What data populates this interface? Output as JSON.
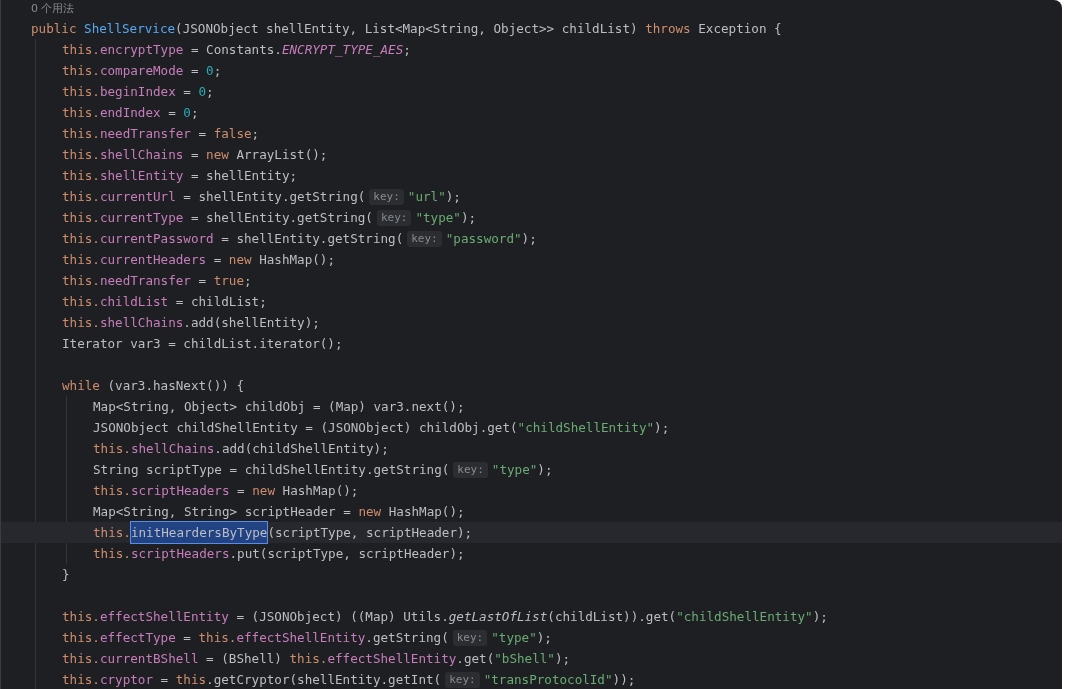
{
  "usage_hint": "0 个用法",
  "lines": [
    {
      "tokens": [
        {
          "kind": "keyword",
          "text": "public "
        },
        {
          "kind": "declaration",
          "text": "ShellService"
        },
        {
          "kind": "plain",
          "text": "(JSONObject shellEntity, List<Map<String, Object>> childList) "
        },
        {
          "kind": "keyword",
          "text": "throws "
        },
        {
          "kind": "plain",
          "text": "Exception {"
        }
      ],
      "children": [
        {
          "tokens": [
            {
              "kind": "receiver",
              "text": "this."
            },
            {
              "kind": "field",
              "text": "encryptType"
            },
            {
              "kind": "plain",
              "text": " = Constants."
            },
            {
              "kind": "constant",
              "text": "ENCRYPT_TYPE_AES"
            },
            {
              "kind": "plain",
              "text": ";"
            }
          ]
        },
        {
          "tokens": [
            {
              "kind": "receiver",
              "text": "this."
            },
            {
              "kind": "field",
              "text": "compareMode"
            },
            {
              "kind": "plain",
              "text": " = "
            },
            {
              "kind": "number",
              "text": "0"
            },
            {
              "kind": "plain",
              "text": ";"
            }
          ]
        },
        {
          "tokens": [
            {
              "kind": "receiver",
              "text": "this."
            },
            {
              "kind": "field",
              "text": "beginIndex"
            },
            {
              "kind": "plain",
              "text": " = "
            },
            {
              "kind": "number",
              "text": "0"
            },
            {
              "kind": "plain",
              "text": ";"
            }
          ]
        },
        {
          "tokens": [
            {
              "kind": "receiver",
              "text": "this."
            },
            {
              "kind": "field",
              "text": "endIndex"
            },
            {
              "kind": "plain",
              "text": " = "
            },
            {
              "kind": "number",
              "text": "0"
            },
            {
              "kind": "plain",
              "text": ";"
            }
          ]
        },
        {
          "tokens": [
            {
              "kind": "receiver",
              "text": "this."
            },
            {
              "kind": "field",
              "text": "needTransfer"
            },
            {
              "kind": "plain",
              "text": " = "
            },
            {
              "kind": "keyword",
              "text": "false"
            },
            {
              "kind": "plain",
              "text": ";"
            }
          ]
        },
        {
          "tokens": [
            {
              "kind": "receiver",
              "text": "this."
            },
            {
              "kind": "field",
              "text": "shellChains"
            },
            {
              "kind": "plain",
              "text": " = "
            },
            {
              "kind": "keyword",
              "text": "new "
            },
            {
              "kind": "plain",
              "text": "ArrayList();"
            }
          ]
        },
        {
          "tokens": [
            {
              "kind": "receiver",
              "text": "this."
            },
            {
              "kind": "field",
              "text": "shellEntity"
            },
            {
              "kind": "plain",
              "text": " = shellEntity;"
            }
          ]
        },
        {
          "tokens": [
            {
              "kind": "receiver",
              "text": "this."
            },
            {
              "kind": "field",
              "text": "currentUrl"
            },
            {
              "kind": "plain",
              "text": " = shellEntity.getString("
            },
            {
              "kind": "hint",
              "text": "key:"
            },
            {
              "kind": "string",
              "text": "\"url\""
            },
            {
              "kind": "plain",
              "text": ");"
            }
          ]
        },
        {
          "tokens": [
            {
              "kind": "receiver",
              "text": "this."
            },
            {
              "kind": "field",
              "text": "currentType"
            },
            {
              "kind": "plain",
              "text": " = shellEntity.getString("
            },
            {
              "kind": "hint",
              "text": "key:"
            },
            {
              "kind": "string",
              "text": "\"type\""
            },
            {
              "kind": "plain",
              "text": ");"
            }
          ]
        },
        {
          "tokens": [
            {
              "kind": "receiver",
              "text": "this."
            },
            {
              "kind": "field",
              "text": "currentPassword"
            },
            {
              "kind": "plain",
              "text": " = shellEntity.getString("
            },
            {
              "kind": "hint",
              "text": "key:"
            },
            {
              "kind": "string",
              "text": "\"password\""
            },
            {
              "kind": "plain",
              "text": ");"
            }
          ]
        },
        {
          "tokens": [
            {
              "kind": "receiver",
              "text": "this."
            },
            {
              "kind": "field",
              "text": "currentHeaders"
            },
            {
              "kind": "plain",
              "text": " = "
            },
            {
              "kind": "keyword",
              "text": "new "
            },
            {
              "kind": "plain",
              "text": "HashMap();"
            }
          ]
        },
        {
          "tokens": [
            {
              "kind": "receiver",
              "text": "this."
            },
            {
              "kind": "field",
              "text": "needTransfer"
            },
            {
              "kind": "plain",
              "text": " = "
            },
            {
              "kind": "keyword",
              "text": "true"
            },
            {
              "kind": "plain",
              "text": ";"
            }
          ]
        },
        {
          "tokens": [
            {
              "kind": "receiver",
              "text": "this."
            },
            {
              "kind": "field",
              "text": "childList"
            },
            {
              "kind": "plain",
              "text": " = childList;"
            }
          ]
        },
        {
          "tokens": [
            {
              "kind": "receiver",
              "text": "this."
            },
            {
              "kind": "field",
              "text": "shellChains"
            },
            {
              "kind": "plain",
              "text": ".add(shellEntity);"
            }
          ]
        },
        {
          "tokens": [
            {
              "kind": "plain",
              "text": "Iterator var3 = childList.iterator();"
            }
          ]
        },
        {
          "kind": "blank"
        },
        {
          "tokens": [
            {
              "kind": "keyword",
              "text": "while "
            },
            {
              "kind": "plain",
              "text": "(var3.hasNext()) {"
            }
          ],
          "children": [
            {
              "tokens": [
                {
                  "kind": "plain",
                  "text": "Map<String, Object> childObj = (Map) var3.next();"
                }
              ]
            },
            {
              "tokens": [
                {
                  "kind": "plain",
                  "text": "JSONObject childShellEntity = (JSONObject) childObj.get("
                },
                {
                  "kind": "string",
                  "text": "\"childShellEntity\""
                },
                {
                  "kind": "plain",
                  "text": ");"
                }
              ]
            },
            {
              "tokens": [
                {
                  "kind": "receiver",
                  "text": "this."
                },
                {
                  "kind": "field",
                  "text": "shellChains"
                },
                {
                  "kind": "plain",
                  "text": ".add(childShellEntity);"
                }
              ]
            },
            {
              "tokens": [
                {
                  "kind": "plain",
                  "text": "String scriptType = childShellEntity.getString("
                },
                {
                  "kind": "hint",
                  "text": "key:"
                },
                {
                  "kind": "string",
                  "text": "\"type\""
                },
                {
                  "kind": "plain",
                  "text": ");"
                }
              ]
            },
            {
              "tokens": [
                {
                  "kind": "receiver",
                  "text": "this."
                },
                {
                  "kind": "field",
                  "text": "scriptHeaders"
                },
                {
                  "kind": "plain",
                  "text": " = "
                },
                {
                  "kind": "keyword",
                  "text": "new "
                },
                {
                  "kind": "plain",
                  "text": "HashMap();"
                }
              ]
            },
            {
              "tokens": [
                {
                  "kind": "plain",
                  "text": "Map<String, String> scriptHeader = "
                },
                {
                  "kind": "keyword",
                  "text": "new "
                },
                {
                  "kind": "plain",
                  "text": "HashMap();"
                }
              ]
            },
            {
              "current": true,
              "tokens": [
                {
                  "kind": "receiver",
                  "text": "this."
                },
                {
                  "kind": "selection",
                  "text": "initHeardersByType"
                },
                {
                  "kind": "plain",
                  "text": "(scriptType, scriptHeader);"
                }
              ]
            },
            {
              "tokens": [
                {
                  "kind": "receiver",
                  "text": "this."
                },
                {
                  "kind": "field",
                  "text": "scriptHeaders"
                },
                {
                  "kind": "plain",
                  "text": ".put(scriptType, scriptHeader);"
                }
              ]
            }
          ]
        },
        {
          "tokens": [
            {
              "kind": "plain",
              "text": "}"
            }
          ]
        },
        {
          "kind": "blank"
        },
        {
          "tokens": [
            {
              "kind": "receiver",
              "text": "this."
            },
            {
              "kind": "field",
              "text": "effectShellEntity"
            },
            {
              "kind": "plain",
              "text": " = (JSONObject) ((Map) Utils."
            },
            {
              "kind": "static_call",
              "text": "getLastOfList"
            },
            {
              "kind": "plain",
              "text": "(childList)).get("
            },
            {
              "kind": "string",
              "text": "\"childShellEntity\""
            },
            {
              "kind": "plain",
              "text": ");"
            }
          ]
        },
        {
          "tokens": [
            {
              "kind": "receiver",
              "text": "this."
            },
            {
              "kind": "field",
              "text": "effectType"
            },
            {
              "kind": "plain",
              "text": " = "
            },
            {
              "kind": "receiver",
              "text": "this."
            },
            {
              "kind": "field",
              "text": "effectShellEntity"
            },
            {
              "kind": "plain",
              "text": ".getString("
            },
            {
              "kind": "hint",
              "text": "key:"
            },
            {
              "kind": "string",
              "text": "\"type\""
            },
            {
              "kind": "plain",
              "text": ");"
            }
          ]
        },
        {
          "tokens": [
            {
              "kind": "receiver",
              "text": "this."
            },
            {
              "kind": "field",
              "text": "currentBShell"
            },
            {
              "kind": "plain",
              "text": " = (BShell) "
            },
            {
              "kind": "receiver",
              "text": "this."
            },
            {
              "kind": "field",
              "text": "effectShellEntity"
            },
            {
              "kind": "plain",
              "text": ".get("
            },
            {
              "kind": "string",
              "text": "\"bShell\""
            },
            {
              "kind": "plain",
              "text": ");"
            }
          ]
        },
        {
          "tokens": [
            {
              "kind": "receiver",
              "text": "this."
            },
            {
              "kind": "field",
              "text": "cryptor"
            },
            {
              "kind": "plain",
              "text": " = "
            },
            {
              "kind": "keyword",
              "text": "this"
            },
            {
              "kind": "plain",
              "text": ".getCryptor(shellEntity.getInt("
            },
            {
              "kind": "hint",
              "text": "key:"
            },
            {
              "kind": "string",
              "text": "\"transProtocolId\""
            },
            {
              "kind": "plain",
              "text": "));"
            }
          ]
        }
      ]
    }
  ]
}
